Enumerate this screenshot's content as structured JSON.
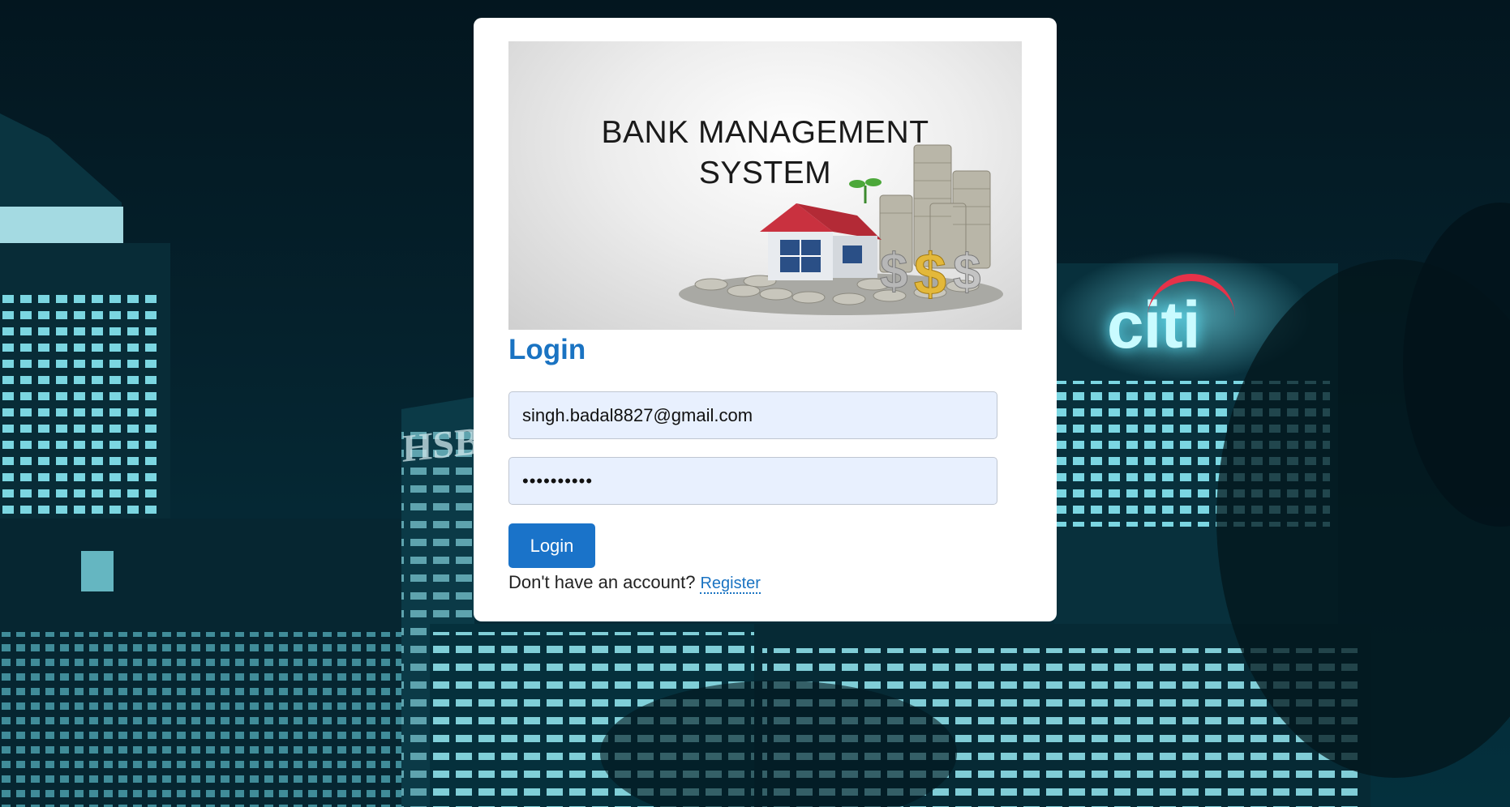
{
  "background": {
    "sign_citi": "citi",
    "sign_hsbc": "HSBC"
  },
  "banner": {
    "title_line1": "BANK MANAGEMENT",
    "title_line2": "SYSTEM"
  },
  "login": {
    "heading": "Login",
    "email_value": "singh.badal8827@gmail.com",
    "password_value": "••••••••••",
    "button_label": "Login",
    "no_account_text": "Don't have an account?",
    "register_link": "Register"
  },
  "colors": {
    "accent": "#1a73c2",
    "input_bg": "#e8f0fe",
    "button_bg": "#1a73c9"
  }
}
